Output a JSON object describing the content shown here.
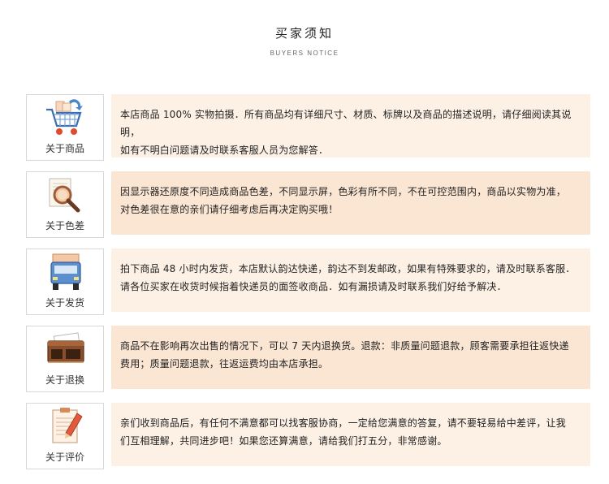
{
  "header": {
    "title": "买家须知",
    "subtitle": "BUYERS NOTICE"
  },
  "items": [
    {
      "label": "关于商品",
      "icon": "shopping-cart-icon",
      "line1": "本店商品 100% 实物拍摄．所有商品均有详细尺寸、材质、标牌以及商品的描述说明，请仔细阅读其说明，",
      "line2": "如有不明白问题请及时联系客服人员为您解答．"
    },
    {
      "label": "关于色差",
      "icon": "magnifier-document-icon",
      "line1": "因显示器还原度不同造成商品色差，不同显示屏，色彩有所不同，不在可控范围内，商品以实物为准，",
      "line2": "对色差很在意的亲们请仔细考虑后再决定购买哦！"
    },
    {
      "label": "关于发货",
      "icon": "delivery-truck-icon",
      "line1": "拍下商品 48 小时内发货，本店默认韵达快递，韵达不到发邮政，如果有特殊要求的，请及时联系客服．",
      "line2": "请各位买家在收货时候指着快递员的面签收商品．如有漏损请及时联系我们好给予解决．"
    },
    {
      "label": "关于退换",
      "icon": "wallet-icon",
      "line1": "商品不在影响再次出售的情况下，可以 7 天内退换货。退款：非质量问题退款，顾客需要承担往返快递",
      "line2": "费用；质量问题退款，往返运费均由本店承担。"
    },
    {
      "label": "关于评价",
      "icon": "clipboard-pen-icon",
      "line1": "亲们收到商品后，有任何不满意都可以找客服协商，一定给您满意的答复，请不要轻易给中差评，让我",
      "line2": "们互相理解，共同进步吧！如果您还算满意，请给我们打五分，非常感谢。"
    }
  ],
  "colors": {
    "panel_light": "#fdf1e6",
    "panel_dark": "#fbe5d3",
    "border": "#d8d8d8"
  }
}
